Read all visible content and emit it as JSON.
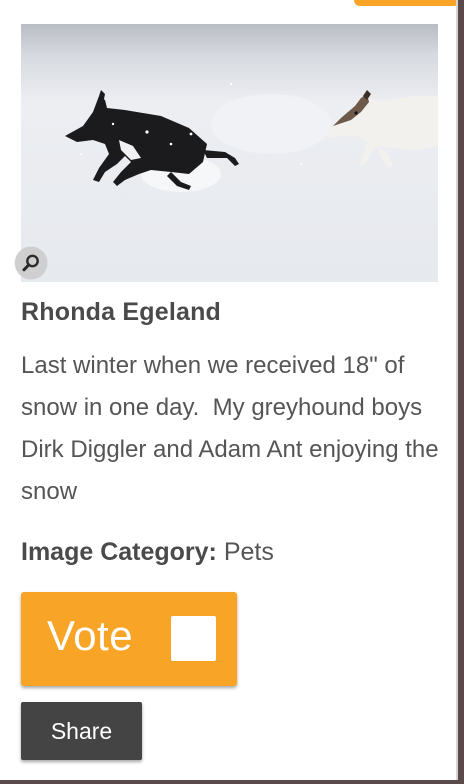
{
  "entry": {
    "author": "Rhonda Egeland",
    "description": "Last winter when we received 18\" of snow in one day.  My greyhound boys Dirk Diggler and Adam Ant enjoying the snow",
    "category_label": "Image Category:",
    "category_value": "Pets"
  },
  "actions": {
    "vote_label": "Vote",
    "vote_checked": false,
    "share_label": "Share"
  },
  "icons": {
    "zoom": "magnifier-icon"
  },
  "colors": {
    "accent": "#f7a427",
    "share_button": "#444444",
    "text": "#555555"
  }
}
